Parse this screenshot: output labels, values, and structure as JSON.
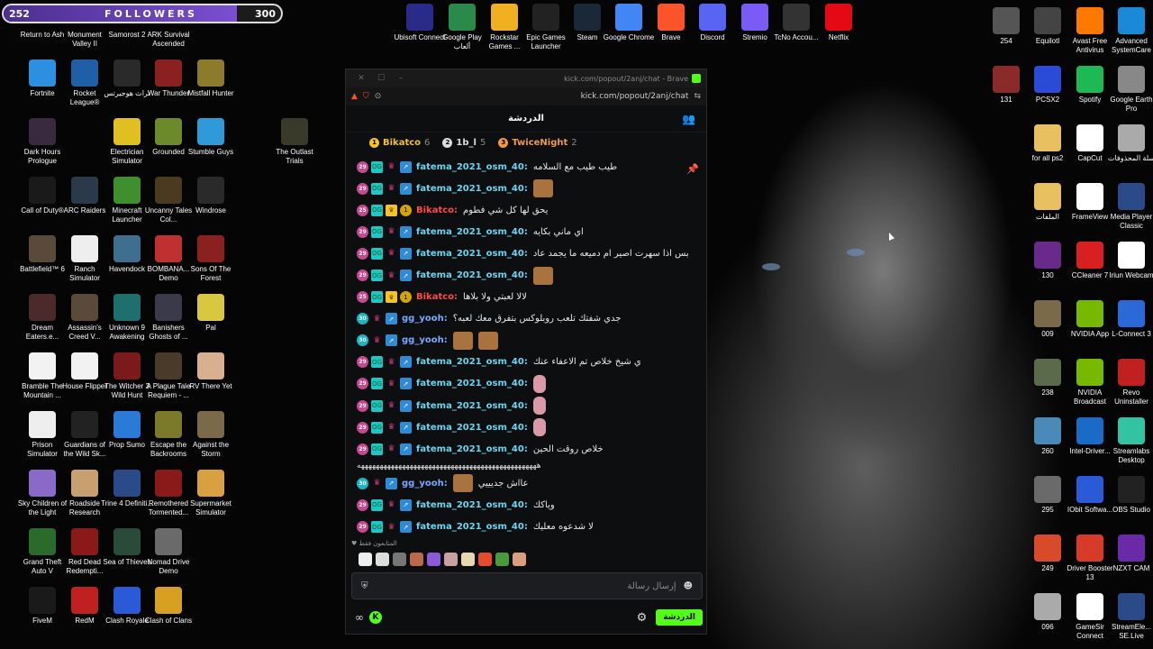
{
  "followers": {
    "current": "252",
    "label": "FOLLOWERS",
    "goal": "300",
    "fraction": 0.84
  },
  "desktop_left": [
    {
      "label": "Return to Ash",
      "icon": "game-icon",
      "color": "#4b3b2b"
    },
    {
      "label": "Monument Valley II",
      "icon": "game-icon",
      "color": "#6b4aa8"
    },
    {
      "label": "Samorost 2",
      "icon": "game-icon",
      "color": "#4e5f2f"
    },
    {
      "label": "ARK Survival Ascended",
      "icon": "game-icon",
      "color": "#345d6b"
    },
    {
      "label": "Fortnite",
      "icon": "fortnite-icon",
      "color": "#2c8fe0"
    },
    {
      "label": "Rocket League®",
      "icon": "rocket-league-icon",
      "color": "#1f5fa8"
    },
    {
      "label": "تراث هوجيرتس",
      "icon": "game-icon",
      "color": "#2a2a2a"
    },
    {
      "label": "War Thunder",
      "icon": "war-thunder-icon",
      "color": "#8a2020"
    },
    {
      "label": "Mistfall Hunter",
      "icon": "game-icon",
      "color": "#8c7b2a"
    },
    {
      "label": "Dark Hours Prologue",
      "icon": "game-icon",
      "color": "#3a2a40"
    },
    {
      "label": "Electrician Simulator",
      "icon": "game-icon",
      "color": "#e0c020"
    },
    {
      "label": "Grounded",
      "icon": "game-icon",
      "color": "#6d8a2a"
    },
    {
      "label": "Stumble Guys",
      "icon": "game-icon",
      "color": "#2f9ad8"
    },
    {
      "label": "The Outlast Trials",
      "icon": "game-icon",
      "color": "#3a3a2a"
    },
    {
      "label": "Call of Duty®",
      "icon": "game-icon",
      "color": "#1a1a1a"
    },
    {
      "label": "ARC Raiders",
      "icon": "game-icon",
      "color": "#2a3a4a"
    },
    {
      "label": "Minecraft Launcher",
      "icon": "minecraft-icon",
      "color": "#3f8f2f"
    },
    {
      "label": "Uncanny Tales Col...",
      "icon": "game-icon",
      "color": "#4a3a20"
    },
    {
      "label": "Windrose",
      "icon": "game-icon",
      "color": "#2a2a2a"
    },
    {
      "label": "Battlefield™ 6",
      "icon": "game-icon",
      "color": "#5a4a3a"
    },
    {
      "label": "Ranch Simulator",
      "icon": "game-icon",
      "color": "#eee"
    },
    {
      "label": "Havendock",
      "icon": "game-icon",
      "color": "#3f6f8f"
    },
    {
      "label": "BOMBANA... Demo",
      "icon": "game-icon",
      "color": "#c03030"
    },
    {
      "label": "Sons Of The Forest",
      "icon": "game-icon",
      "color": "#8a2020"
    },
    {
      "label": "Dream Eaters.e...",
      "icon": "game-icon",
      "color": "#4a2a2a"
    },
    {
      "label": "Assassin's Creed V...",
      "icon": "game-icon",
      "color": "#5a4a3a"
    },
    {
      "label": "Unknown 9 Awakening",
      "icon": "game-icon",
      "color": "#1f6f6f"
    },
    {
      "label": "Banishers Ghosts of ...",
      "icon": "game-icon",
      "color": "#3a3a4a"
    },
    {
      "label": "Pal",
      "icon": "game-icon",
      "color": "#d8c840"
    },
    {
      "label": "Bramble The Mountain ...",
      "icon": "file-icon",
      "color": "#f2f2f2"
    },
    {
      "label": "House Flipper",
      "icon": "file-icon",
      "color": "#f2f2f2"
    },
    {
      "label": "The Witcher 3 Wild Hunt",
      "icon": "game-icon",
      "color": "#7a1a1a"
    },
    {
      "label": "A Plague Tale Requiem - ...",
      "icon": "game-icon",
      "color": "#4a3a2a"
    },
    {
      "label": "RV There Yet",
      "icon": "game-icon",
      "color": "#d8b090"
    },
    {
      "label": "Prison Simulator",
      "icon": "game-icon",
      "color": "#eee"
    },
    {
      "label": "Guardians of the Wild Sk...",
      "icon": "game-icon",
      "color": "#222"
    },
    {
      "label": "Prop Sumo",
      "icon": "game-icon",
      "color": "#2a7ad8"
    },
    {
      "label": "Escape the Backrooms",
      "icon": "game-icon",
      "color": "#7a7a2a"
    },
    {
      "label": "Against the Storm",
      "icon": "game-icon",
      "color": "#7a6a4a"
    },
    {
      "label": "Sky Children of the Light",
      "icon": "game-icon",
      "color": "#8a6ac8"
    },
    {
      "label": "Roadside Research",
      "icon": "game-icon",
      "color": "#c8a070"
    },
    {
      "label": "Trine 4 Definiti...",
      "icon": "game-icon",
      "color": "#2a4a8a"
    },
    {
      "label": "Remothered Tormented...",
      "icon": "game-icon",
      "color": "#8a1a1a"
    },
    {
      "label": "Supermarket Simulator",
      "icon": "game-icon",
      "color": "#d8a040"
    },
    {
      "label": "Grand Theft Auto V",
      "icon": "gta-icon",
      "color": "#2a6a2a"
    },
    {
      "label": "Red Dead Redempti...",
      "icon": "game-icon",
      "color": "#8a1a1a"
    },
    {
      "label": "Sea of Thieves",
      "icon": "game-icon",
      "color": "#2a4a3a"
    },
    {
      "label": "Nomad Drive Demo",
      "icon": "game-icon",
      "color": "#6a6a6a"
    },
    {
      "label": "FiveM",
      "icon": "fivem-icon",
      "color": "#1a1a1a"
    },
    {
      "label": "RedM",
      "icon": "redm-icon",
      "color": "#c02020"
    },
    {
      "label": "Clash Royale",
      "icon": "game-icon",
      "color": "#2a5ad8"
    },
    {
      "label": "Clash of Clans",
      "icon": "game-icon",
      "color": "#d8a020"
    }
  ],
  "desktop_top": [
    {
      "label": "Ubisoft Connect",
      "icon": "ubisoft-icon",
      "color": "#2a2a8a"
    },
    {
      "label": "Google Play ألعاب",
      "icon": "google-play-icon",
      "color": "#2a8a4a"
    },
    {
      "label": "Rockstar Games ...",
      "icon": "rockstar-icon",
      "color": "#f0b020"
    },
    {
      "label": "Epic Games Launcher",
      "icon": "epic-games-icon",
      "color": "#222"
    },
    {
      "label": "Steam",
      "icon": "steam-icon",
      "color": "#1b2838"
    },
    {
      "label": "Google Chrome",
      "icon": "chrome-icon",
      "color": "#4285f4"
    },
    {
      "label": "Brave",
      "icon": "brave-icon",
      "color": "#fb542b"
    },
    {
      "label": "Discord",
      "icon": "discord-icon",
      "color": "#5865f2"
    },
    {
      "label": "Stremio",
      "icon": "stremio-icon",
      "color": "#7b5bf5"
    },
    {
      "label": "TcNo Accou...",
      "icon": "tcno-icon",
      "color": "#333"
    },
    {
      "label": "Netflix",
      "icon": "netflix-icon",
      "color": "#e50914"
    }
  ],
  "desktop_right": [
    {
      "label": "254",
      "icon": "image-icon",
      "color": "#555"
    },
    {
      "label": "Equilotl",
      "icon": "app-icon",
      "color": "#444"
    },
    {
      "label": "Avast Free Antivirus",
      "icon": "avast-icon",
      "color": "#ff7800"
    },
    {
      "label": "Advanced SystemCare",
      "icon": "app-icon",
      "color": "#1a8ad8"
    },
    {
      "label": "131",
      "icon": "image-icon",
      "color": "#8a2a2a"
    },
    {
      "label": "PCSX2",
      "icon": "pcsx2-icon",
      "color": "#2a4ad8"
    },
    {
      "label": "Spotify",
      "icon": "spotify-icon",
      "color": "#1db954"
    },
    {
      "label": "Google Earth Pro",
      "icon": "earth-icon",
      "color": "#888"
    },
    {
      "label": "for all ps2",
      "icon": "folder-icon",
      "color": "#e8c060"
    },
    {
      "label": "CapCut",
      "icon": "capcut-icon",
      "color": "#fff"
    },
    {
      "label": "سلة المحذوفات",
      "icon": "recycle-bin-icon",
      "color": "#aaa"
    },
    {
      "label": "الملفات",
      "icon": "folder-icon",
      "color": "#e8c060"
    },
    {
      "label": "FrameView",
      "icon": "app-icon",
      "color": "#fff"
    },
    {
      "label": "Media Player Classic",
      "icon": "app-icon",
      "color": "#2a4a8a"
    },
    {
      "label": "130",
      "icon": "image-icon",
      "color": "#6a2a8a"
    },
    {
      "label": "CCleaner 7",
      "icon": "ccleaner-icon",
      "color": "#d82020"
    },
    {
      "label": "Iriun Webcam",
      "icon": "app-icon",
      "color": "#fff"
    },
    {
      "label": "009",
      "icon": "image-icon",
      "color": "#7a6a4a"
    },
    {
      "label": "NVIDIA App",
      "icon": "nvidia-icon",
      "color": "#76b900"
    },
    {
      "label": "L-Connect 3",
      "icon": "app-icon",
      "color": "#2a6ad8"
    },
    {
      "label": "238",
      "icon": "image-icon",
      "color": "#5a6a4a"
    },
    {
      "label": "NVIDIA Broadcast",
      "icon": "nvidia-icon",
      "color": "#76b900"
    },
    {
      "label": "Revo Uninstaller",
      "icon": "app-icon",
      "color": "#c02020"
    },
    {
      "label": "260",
      "icon": "image-icon",
      "color": "#4a8ab8"
    },
    {
      "label": "Intel-Driver...",
      "icon": "app-icon",
      "color": "#1a6ac8"
    },
    {
      "label": "Streamlabs Desktop",
      "icon": "streamlabs-icon",
      "color": "#31c3a2"
    },
    {
      "label": "295",
      "icon": "image-icon",
      "color": "#6a6a6a"
    },
    {
      "label": "IObit Softwa...",
      "icon": "app-icon",
      "color": "#2a5ad8"
    },
    {
      "label": "OBS Studio",
      "icon": "obs-icon",
      "color": "#222"
    },
    {
      "label": "249",
      "icon": "image-icon",
      "color": "#d84a2a"
    },
    {
      "label": "Driver Booster 13",
      "icon": "app-icon",
      "color": "#d83a2a"
    },
    {
      "label": "NZXT CAM",
      "icon": "app-icon",
      "color": "#6a2aa8"
    },
    {
      "label": "096",
      "icon": "image-icon",
      "color": "#aaa"
    },
    {
      "label": "GameSir Connect",
      "icon": "app-icon",
      "color": "#fff"
    },
    {
      "label": "StreamEle... SE.Live",
      "icon": "app-icon",
      "color": "#2a4a8a"
    }
  ],
  "chat": {
    "window_title": "kick.com/popout/2anj/chat - Brave",
    "url": "kick.com/popout/2anj/chat",
    "header_title": "الدردشة",
    "top_gifters": [
      {
        "rank": "1",
        "name": "Bikatco",
        "count": "6",
        "color": "#f7c128"
      },
      {
        "rank": "2",
        "name": "1b_l",
        "count": "5",
        "color": "#ddd"
      },
      {
        "rank": "3",
        "name": "TwiceNight",
        "count": "2",
        "color": "#f09a40"
      }
    ],
    "messages": [
      {
        "sub": "29",
        "kind": "fatema",
        "user": "fatema_2021_osm_40:",
        "text": "طيب طيب مع السلامه",
        "emote": ""
      },
      {
        "sub": "29",
        "kind": "fatema",
        "user": "fatema_2021_osm_40:",
        "text": "",
        "emote": "face"
      },
      {
        "sub": "25",
        "kind": "bika",
        "user": "Bikatco:",
        "text": "يحق لها كل شي فطوم",
        "emote": ""
      },
      {
        "sub": "29",
        "kind": "fatema",
        "user": "fatema_2021_osm_40:",
        "text": "اي ماني بكايه",
        "emote": ""
      },
      {
        "sub": "29",
        "kind": "fatema",
        "user": "fatema_2021_osm_40:",
        "text": "بس اذا سهرت اصير ام دميعه ما يجمد عاد",
        "emote": ""
      },
      {
        "sub": "29",
        "kind": "fatema",
        "user": "fatema_2021_osm_40:",
        "text": "",
        "emote": "face"
      },
      {
        "sub": "25",
        "kind": "bika",
        "user": "Bikatco:",
        "text": "لالا لعبتي ولا بلاها",
        "emote": ""
      },
      {
        "sub": "30",
        "kind": "gg",
        "user": "gg_yooh:",
        "text": "جدي شفتك تلعب روبلوكس بتفرق معك لعبه؟",
        "emote": ""
      },
      {
        "sub": "30",
        "kind": "gg",
        "user": "gg_yooh:",
        "text": "",
        "emote": "double"
      },
      {
        "sub": "29",
        "kind": "fatema",
        "user": "fatema_2021_osm_40:",
        "text": "ي شيخ خلاص تم الاعفاء عنك",
        "emote": ""
      },
      {
        "sub": "29",
        "kind": "fatema",
        "user": "fatema_2021_osm_40:",
        "text": "",
        "emote": "pig"
      },
      {
        "sub": "29",
        "kind": "fatema",
        "user": "fatema_2021_osm_40:",
        "text": "",
        "emote": "pig"
      },
      {
        "sub": "29",
        "kind": "fatema",
        "user": "fatema_2021_osm_40:",
        "text": "",
        "emote": "pig"
      },
      {
        "sub": "29",
        "kind": "fatema",
        "user": "fatema_2021_osm_40:",
        "text": "خلاص روقت الحين",
        "emote": ""
      },
      {
        "sub": "",
        "kind": "line",
        "user": "",
        "text": "ههههههههههههههههههههههههههههههههههههههههههههههههه",
        "emote": ""
      },
      {
        "sub": "30",
        "kind": "gg",
        "user": "gg_yooh:",
        "text": "عااش جديييي",
        "emote": "face-before"
      },
      {
        "sub": "29",
        "kind": "fatema",
        "user": "fatema_2021_osm_40:",
        "text": "وياكك",
        "emote": ""
      },
      {
        "sub": "29",
        "kind": "fatema",
        "user": "fatema_2021_osm_40:",
        "text": "لا شدعوه معليك",
        "emote": ""
      }
    ],
    "followers_only": "المتابعون فقط",
    "input_placeholder": "إرسال رسالة",
    "send_label": "الدردشة"
  },
  "colors": {
    "kick_green": "#53fc18",
    "fatema": "#68d6f0",
    "bika": "#ff4a4a",
    "gg": "#7aa8ff"
  }
}
